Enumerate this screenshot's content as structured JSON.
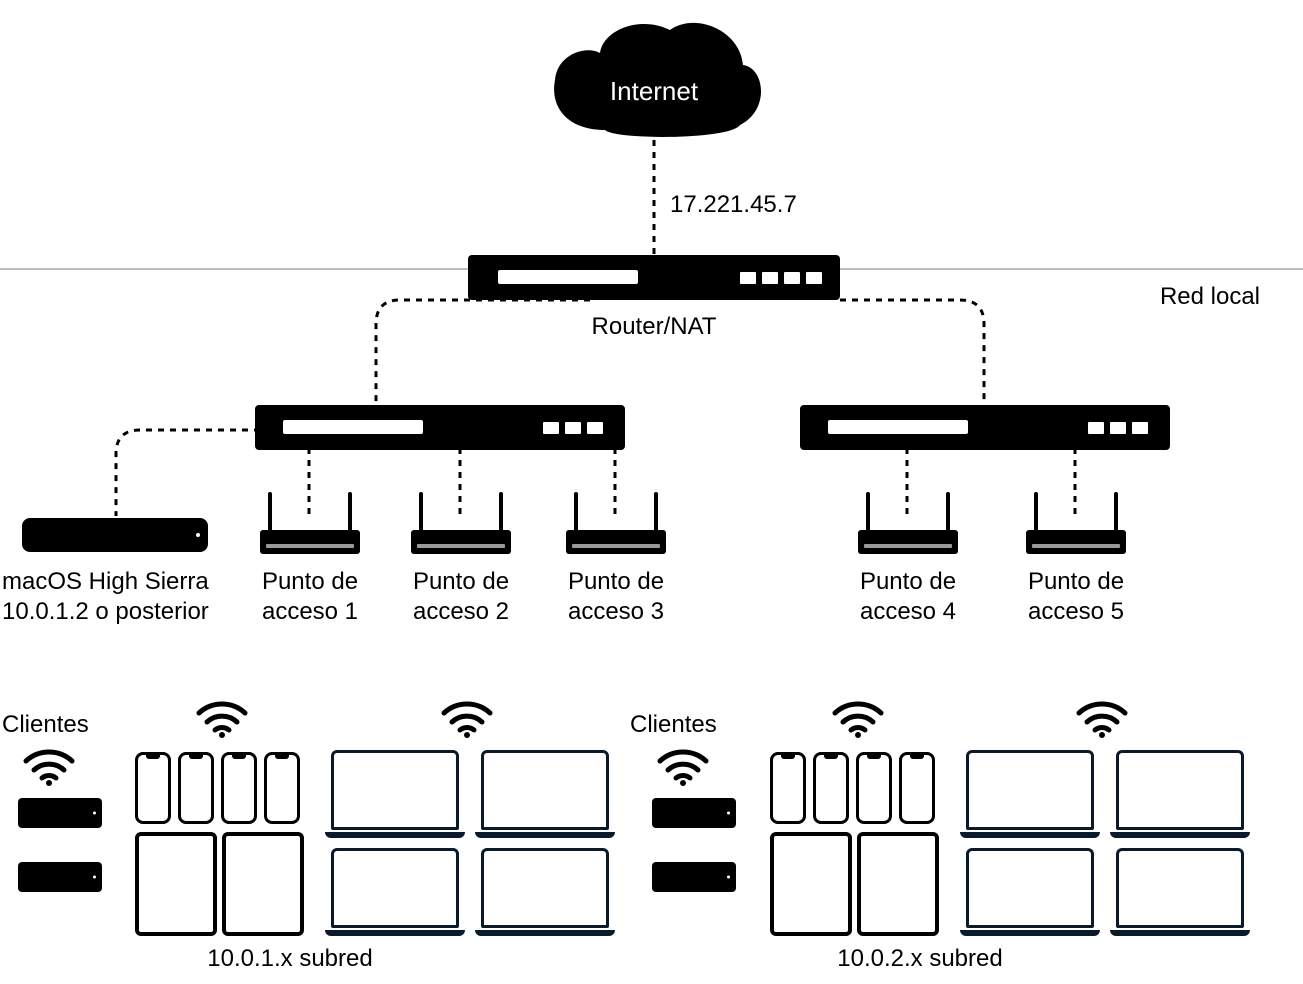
{
  "cloud_label": "Internet",
  "wan_ip": "17.221.45.7",
  "router_label": "Router/NAT",
  "lan_label": "Red local",
  "caching_server": {
    "line1": "macOS High Sierra",
    "line2": "10.0.1.2 o posterior"
  },
  "access_points": [
    {
      "line1": "Punto de",
      "line2": "acceso 1"
    },
    {
      "line1": "Punto de",
      "line2": "acceso 2"
    },
    {
      "line1": "Punto de",
      "line2": "acceso 3"
    },
    {
      "line1": "Punto de",
      "line2": "acceso 4"
    },
    {
      "line1": "Punto de",
      "line2": "acceso 5"
    }
  ],
  "clients_label_1": "Clientes",
  "clients_label_2": "Clientes",
  "subnet_1": "10.0.1.x subred",
  "subnet_2": "10.0.2.x subred"
}
